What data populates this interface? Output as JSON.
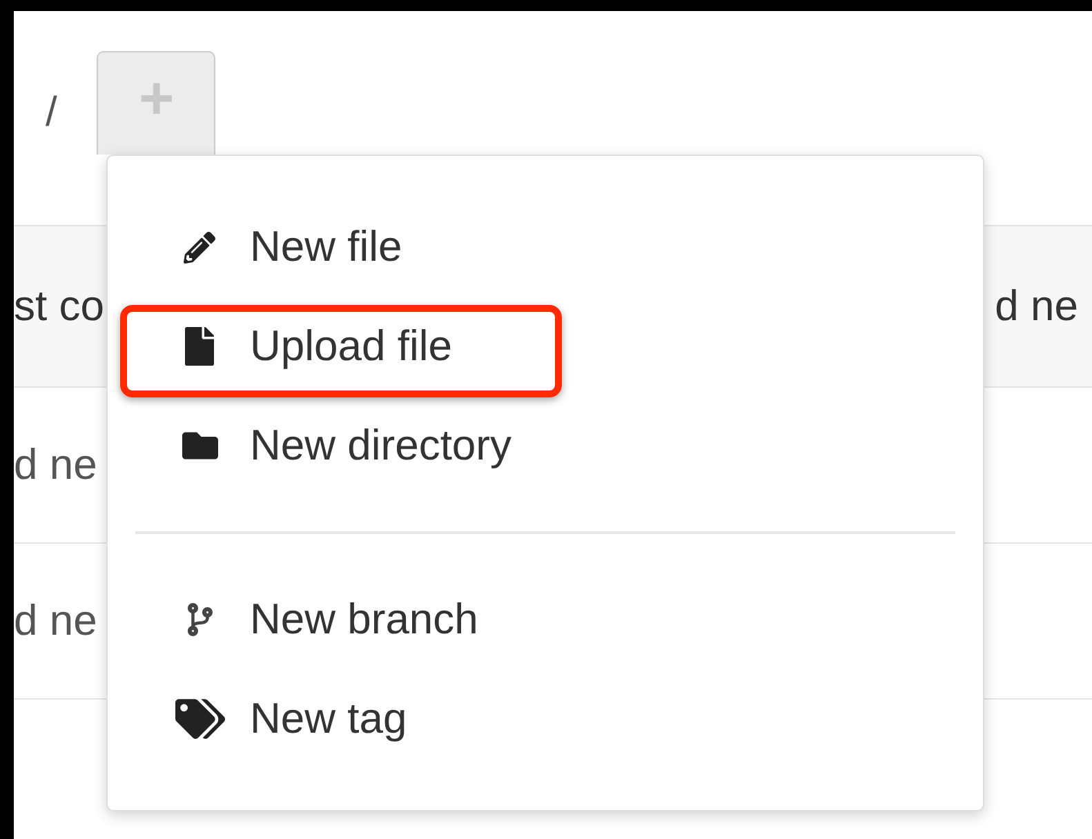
{
  "breadcrumb": {
    "separator": "/"
  },
  "add_button": {
    "label": "+",
    "expanded": true
  },
  "table": {
    "header": {
      "column_1": "st co",
      "column_2": "d ne"
    },
    "rows": [
      {
        "column_1": "d ne"
      },
      {
        "column_1": "d ne"
      }
    ]
  },
  "dropdown": {
    "groups": [
      {
        "items": [
          {
            "kind": "pencil",
            "label": "New file",
            "highlighted": false
          },
          {
            "kind": "file",
            "label": "Upload file",
            "highlighted": true
          },
          {
            "kind": "folder",
            "label": "New directory",
            "highlighted": false
          }
        ]
      },
      {
        "items": [
          {
            "kind": "branch",
            "label": "New branch",
            "highlighted": false
          },
          {
            "kind": "tags",
            "label": "New tag",
            "highlighted": false
          }
        ]
      }
    ]
  }
}
